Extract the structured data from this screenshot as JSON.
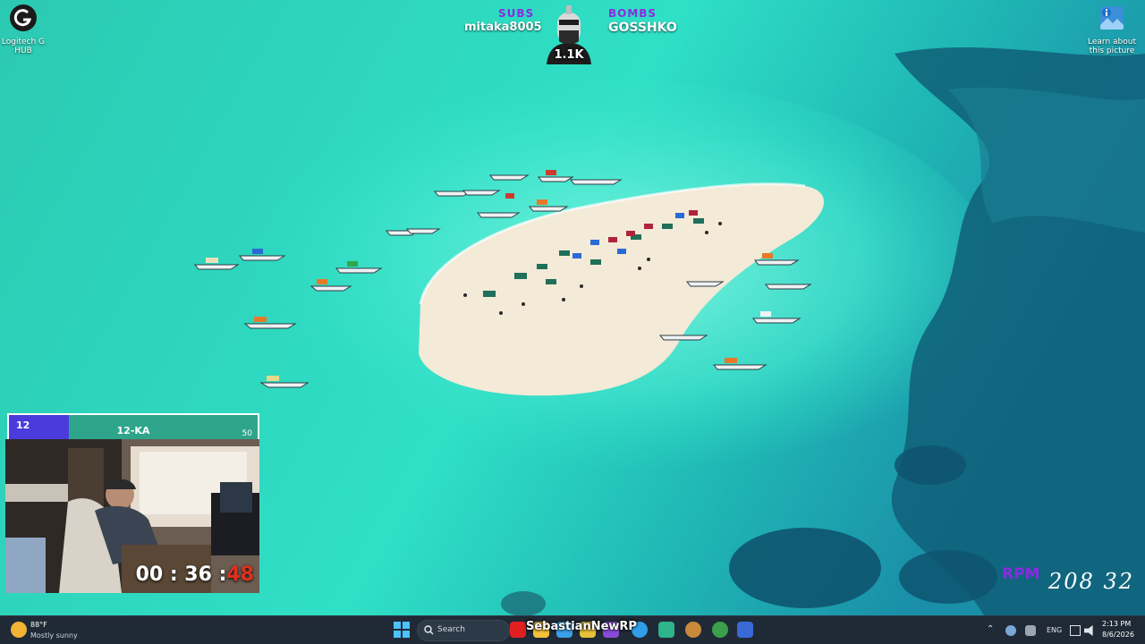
{
  "desktop": {
    "icons": [
      {
        "label": "Logitech G HUB"
      },
      {
        "label": "Learn about this picture"
      }
    ]
  },
  "stream_overlay": {
    "subs_label": "SUBS",
    "subs_name": "mitaka8005",
    "bombs_label": "BOMBS",
    "bombs_name": "GOSSHKO",
    "count": "1.1K"
  },
  "goal_bar": {
    "current": "12",
    "title": "12-KA",
    "target": "50",
    "progress": 0.24
  },
  "webcam": {
    "timer_main": "00 : 36 :",
    "timer_red": "48"
  },
  "rpm_widget": {
    "label": "RPM",
    "value": "208 32"
  },
  "taskbar": {
    "weather_temp": "88°F",
    "weather_condition": "Mostly sunny",
    "search_placeholder": "Search",
    "stream_name": "SebastianNewRP",
    "language": "ENG",
    "time": "2:13 PM",
    "date": "8/6/2026"
  },
  "colors": {
    "accent_purple": "#8a2be2",
    "goal_fill": "#4b3bdc",
    "goal_bg": "#2ea58a",
    "taskbar": "#1f2a36"
  }
}
